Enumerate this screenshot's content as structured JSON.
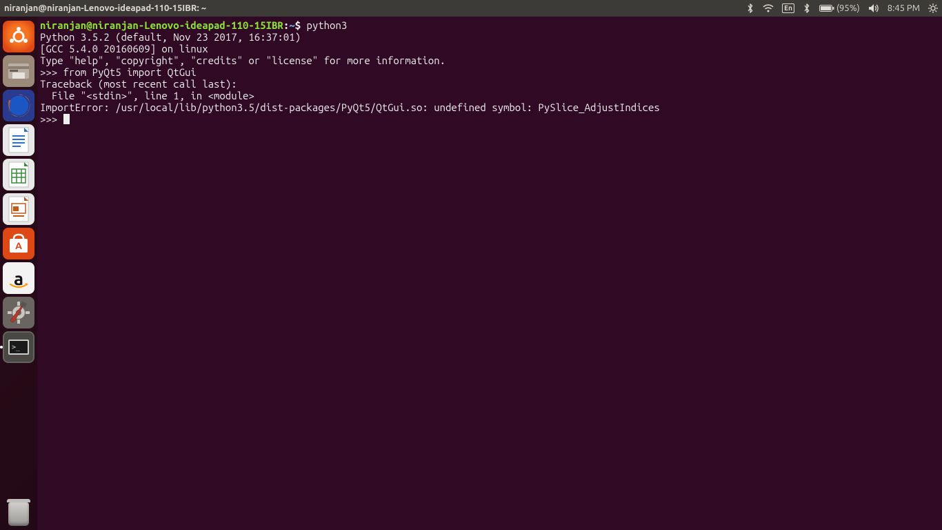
{
  "menubar": {
    "window_title": "niranjan@niranjan-Lenovo-ideapad-110-15IBR: ~",
    "input_indicator": "En",
    "battery_text": "(95%)",
    "clock": "8:45 PM"
  },
  "launcher": {
    "items": [
      {
        "name": "ubuntu-dash",
        "class": "ubuntu"
      },
      {
        "name": "files",
        "class": "files"
      },
      {
        "name": "firefox",
        "class": "firefox"
      },
      {
        "name": "libreoffice-writer",
        "class": "writer"
      },
      {
        "name": "libreoffice-calc",
        "class": "calc"
      },
      {
        "name": "libreoffice-impress",
        "class": "impress"
      },
      {
        "name": "ubuntu-software",
        "class": "store"
      },
      {
        "name": "amazon",
        "class": "amazon"
      },
      {
        "name": "system-settings",
        "class": "settings"
      },
      {
        "name": "terminal",
        "class": "terminal",
        "active": true
      }
    ],
    "trash": {
      "name": "trash"
    }
  },
  "terminal": {
    "prompt_user": "niranjan@niranjan-Lenovo-ideapad-110-15IBR",
    "prompt_sep": ":",
    "prompt_path": "~",
    "prompt_end": "$ ",
    "command": "python3",
    "lines": [
      "Python 3.5.2 (default, Nov 23 2017, 16:37:01) ",
      "[GCC 5.4.0 20160609] on linux",
      "Type \"help\", \"copyright\", \"credits\" or \"license\" for more information.",
      ">>> from PyQt5 import QtGui",
      "Traceback (most recent call last):",
      "  File \"<stdin>\", line 1, in <module>",
      "ImportError: /usr/local/lib/python3.5/dist-packages/PyQt5/QtGui.so: undefined symbol: PySlice_AdjustIndices"
    ],
    "repl_prompt": ">>> "
  }
}
